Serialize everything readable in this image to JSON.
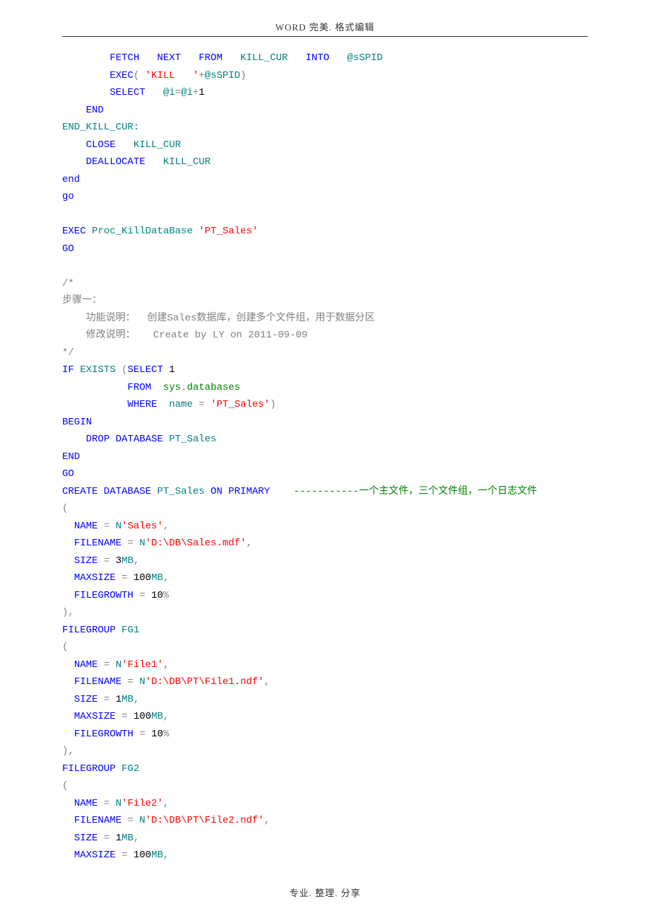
{
  "header": "WORD 完美. 格式编辑",
  "footer": "专业. 整理. 分享",
  "code": [
    [
      {
        "t": "        "
      },
      {
        "t": "FETCH   NEXT   FROM   ",
        "c": "kw"
      },
      {
        "t": "KILL_CUR   ",
        "c": "id"
      },
      {
        "t": "INTO   ",
        "c": "kw"
      },
      {
        "t": "@sSPID",
        "c": "id"
      }
    ],
    [
      {
        "t": "        "
      },
      {
        "t": "EXEC",
        "c": "kw"
      },
      {
        "t": "( "
      },
      {
        "t": "'KILL   '",
        "c": "str"
      },
      {
        "t": "+"
      },
      {
        "t": "@sSPID",
        "c": "id"
      },
      {
        "t": ")"
      }
    ],
    [
      {
        "t": "        "
      },
      {
        "t": "SELECT   ",
        "c": "kw"
      },
      {
        "t": "@i",
        "c": "id"
      },
      {
        "t": "="
      },
      {
        "t": "@i",
        "c": "id"
      },
      {
        "t": "+"
      },
      {
        "t": "1",
        "c": "num"
      }
    ],
    [
      {
        "t": "    "
      },
      {
        "t": "END",
        "c": "kw"
      }
    ],
    [
      {
        "t": "END_KILL_CUR:",
        "c": "id"
      }
    ],
    [
      {
        "t": "    "
      },
      {
        "t": "CLOSE   ",
        "c": "kw"
      },
      {
        "t": "KILL_CUR",
        "c": "id"
      }
    ],
    [
      {
        "t": "    "
      },
      {
        "t": "DEALLOCATE   ",
        "c": "kw"
      },
      {
        "t": "KILL_CUR",
        "c": "id"
      }
    ],
    [
      {
        "t": "end",
        "c": "kw"
      }
    ],
    [
      {
        "t": "go",
        "c": "kw"
      }
    ],
    [
      {
        "t": ""
      }
    ],
    [
      {
        "t": "EXEC ",
        "c": "kw"
      },
      {
        "t": "Proc_KillDataBase ",
        "c": "id"
      },
      {
        "t": "'PT_Sales'",
        "c": "str"
      }
    ],
    [
      {
        "t": "GO",
        "c": "kw"
      }
    ],
    [
      {
        "t": ""
      }
    ],
    [
      {
        "t": "/*",
        "c": "op"
      }
    ],
    [
      {
        "t": "步骤一：",
        "c": "op"
      }
    ],
    [
      {
        "t": "    功能说明：  创建Sales数据库，创建多个文件组，用于数据分区",
        "c": "op"
      }
    ],
    [
      {
        "t": "    修改说明：   Create by LY on 2011-09-09",
        "c": "op"
      }
    ],
    [
      {
        "t": "*/",
        "c": "op"
      }
    ],
    [
      {
        "t": "IF ",
        "c": "kw"
      },
      {
        "t": "EXISTS ",
        "c": "id"
      },
      {
        "t": "("
      },
      {
        "t": "SELECT ",
        "c": "kw"
      },
      {
        "t": "1",
        "c": "num"
      }
    ],
    [
      {
        "t": "           "
      },
      {
        "t": "FROM  ",
        "c": "kw"
      },
      {
        "t": "sys",
        "c": "cm"
      },
      {
        "t": "."
      },
      {
        "t": "databases",
        "c": "cm"
      }
    ],
    [
      {
        "t": "           "
      },
      {
        "t": "WHERE  ",
        "c": "kw"
      },
      {
        "t": "name",
        "c": "id"
      },
      {
        "t": " = "
      },
      {
        "t": "'PT_Sales'",
        "c": "str"
      },
      {
        "t": ")"
      }
    ],
    [
      {
        "t": "BEGIN",
        "c": "kw"
      }
    ],
    [
      {
        "t": "    "
      },
      {
        "t": "DROP DATABASE ",
        "c": "kw"
      },
      {
        "t": "PT_Sales",
        "c": "id"
      }
    ],
    [
      {
        "t": "END",
        "c": "kw"
      }
    ],
    [
      {
        "t": "GO",
        "c": "kw"
      }
    ],
    [
      {
        "t": "CREATE DATABASE ",
        "c": "kw"
      },
      {
        "t": "PT_Sales ",
        "c": "id"
      },
      {
        "t": "ON PRIMARY    ",
        "c": "kw"
      },
      {
        "t": "-----------",
        "c": "cm"
      },
      {
        "t": "一个主文件，三个文件组，一个日志文件",
        "c": "cm"
      }
    ],
    [
      {
        "t": "("
      }
    ],
    [
      {
        "t": "  "
      },
      {
        "t": "NAME ",
        "c": "kw"
      },
      {
        "t": "= "
      },
      {
        "t": "N",
        "c": "id"
      },
      {
        "t": "'Sales'",
        "c": "str"
      },
      {
        "t": ","
      }
    ],
    [
      {
        "t": "  "
      },
      {
        "t": "FILENAME ",
        "c": "kw"
      },
      {
        "t": "= "
      },
      {
        "t": "N",
        "c": "id"
      },
      {
        "t": "'D:\\DB\\Sales.mdf'",
        "c": "str"
      },
      {
        "t": ","
      }
    ],
    [
      {
        "t": "  "
      },
      {
        "t": "SIZE ",
        "c": "kw"
      },
      {
        "t": "= "
      },
      {
        "t": "3",
        "c": "num"
      },
      {
        "t": "MB",
        "c": "id"
      },
      {
        "t": ","
      }
    ],
    [
      {
        "t": "  "
      },
      {
        "t": "MAXSIZE ",
        "c": "kw"
      },
      {
        "t": "= "
      },
      {
        "t": "100",
        "c": "num"
      },
      {
        "t": "MB",
        "c": "id"
      },
      {
        "t": ","
      }
    ],
    [
      {
        "t": "  "
      },
      {
        "t": "FILEGROWTH ",
        "c": "kw"
      },
      {
        "t": "= "
      },
      {
        "t": "10",
        "c": "num"
      },
      {
        "t": "%"
      }
    ],
    [
      {
        "t": "),"
      }
    ],
    [
      {
        "t": "FILEGROUP ",
        "c": "kw"
      },
      {
        "t": "FG1",
        "c": "id"
      }
    ],
    [
      {
        "t": "("
      }
    ],
    [
      {
        "t": "  "
      },
      {
        "t": "NAME ",
        "c": "kw"
      },
      {
        "t": "= "
      },
      {
        "t": "N",
        "c": "id"
      },
      {
        "t": "'File1'",
        "c": "str"
      },
      {
        "t": ","
      }
    ],
    [
      {
        "t": "  "
      },
      {
        "t": "FILENAME ",
        "c": "kw"
      },
      {
        "t": "= "
      },
      {
        "t": "N",
        "c": "id"
      },
      {
        "t": "'D:\\DB\\PT\\File1.ndf'",
        "c": "str"
      },
      {
        "t": ","
      }
    ],
    [
      {
        "t": "  "
      },
      {
        "t": "SIZE ",
        "c": "kw"
      },
      {
        "t": "= "
      },
      {
        "t": "1",
        "c": "num"
      },
      {
        "t": "MB",
        "c": "id"
      },
      {
        "t": ","
      }
    ],
    [
      {
        "t": "  "
      },
      {
        "t": "MAXSIZE ",
        "c": "kw"
      },
      {
        "t": "= "
      },
      {
        "t": "100",
        "c": "num"
      },
      {
        "t": "MB",
        "c": "id"
      },
      {
        "t": ","
      }
    ],
    [
      {
        "t": "  "
      },
      {
        "t": "FILEGROWTH ",
        "c": "kw"
      },
      {
        "t": "= "
      },
      {
        "t": "10",
        "c": "num"
      },
      {
        "t": "%"
      }
    ],
    [
      {
        "t": "),"
      }
    ],
    [
      {
        "t": "FILEGROUP ",
        "c": "kw"
      },
      {
        "t": "FG2",
        "c": "id"
      }
    ],
    [
      {
        "t": "("
      }
    ],
    [
      {
        "t": "  "
      },
      {
        "t": "NAME ",
        "c": "kw"
      },
      {
        "t": "= "
      },
      {
        "t": "N",
        "c": "id"
      },
      {
        "t": "'File2'",
        "c": "str"
      },
      {
        "t": ","
      }
    ],
    [
      {
        "t": "  "
      },
      {
        "t": "FILENAME ",
        "c": "kw"
      },
      {
        "t": "= "
      },
      {
        "t": "N",
        "c": "id"
      },
      {
        "t": "'D:\\DB\\PT\\File2.ndf'",
        "c": "str"
      },
      {
        "t": ","
      }
    ],
    [
      {
        "t": "  "
      },
      {
        "t": "SIZE ",
        "c": "kw"
      },
      {
        "t": "= "
      },
      {
        "t": "1",
        "c": "num"
      },
      {
        "t": "MB",
        "c": "id"
      },
      {
        "t": ","
      }
    ],
    [
      {
        "t": "  "
      },
      {
        "t": "MAXSIZE ",
        "c": "kw"
      },
      {
        "t": "= "
      },
      {
        "t": "100",
        "c": "num"
      },
      {
        "t": "MB",
        "c": "id"
      },
      {
        "t": ","
      }
    ]
  ]
}
